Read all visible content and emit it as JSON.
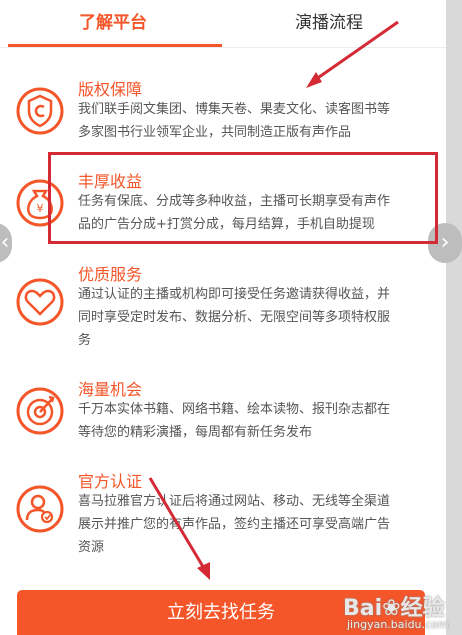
{
  "tabs": [
    {
      "label": "了解平台",
      "active": true
    },
    {
      "label": "演播流程",
      "active": false
    }
  ],
  "features": [
    {
      "title": "版权保障",
      "icon": "copyright-shield-icon",
      "desc": [
        "我们联手阅文集团、博集天卷、果麦文化、读客图书等",
        "多家图书行业领军企业，共同制造正版有声作品"
      ]
    },
    {
      "title": "丰厚收益",
      "icon": "money-bag-icon",
      "desc": [
        "任务有保底、分成等多种收益，主播可长期享受有声作",
        "品的广告分成+打赏分成，每月结算，手机自助提现"
      ]
    },
    {
      "title": "优质服务",
      "icon": "heart-icon",
      "desc": [
        "通过认证的主播或机构即可接受任务邀请获得收益，并",
        "同时享受定时发布、数据分析、无限空间等多项特权服",
        "务"
      ]
    },
    {
      "title": "海量机会",
      "icon": "target-icon",
      "desc": [
        "千万本实体书籍、网络书籍、绘本读物、报刊杂志都在",
        "等待您的精彩演播，每周都有新任务发布"
      ]
    },
    {
      "title": "官方认证",
      "icon": "certified-user-icon",
      "desc": [
        "喜马拉雅官方认证后将通过网站、移动、无线等全渠道",
        "展示并推广您的有声作品，签约主播还可享受高端广告",
        "资源"
      ]
    }
  ],
  "cta_label": "立刻去找任务",
  "nav": {
    "left": "‹",
    "right": "›"
  },
  "watermark": {
    "logo": "Bai❀经验",
    "url": "jingyan.baidu.com"
  },
  "colors": {
    "accent": "#f4562a",
    "annotation": "#d42a35"
  }
}
